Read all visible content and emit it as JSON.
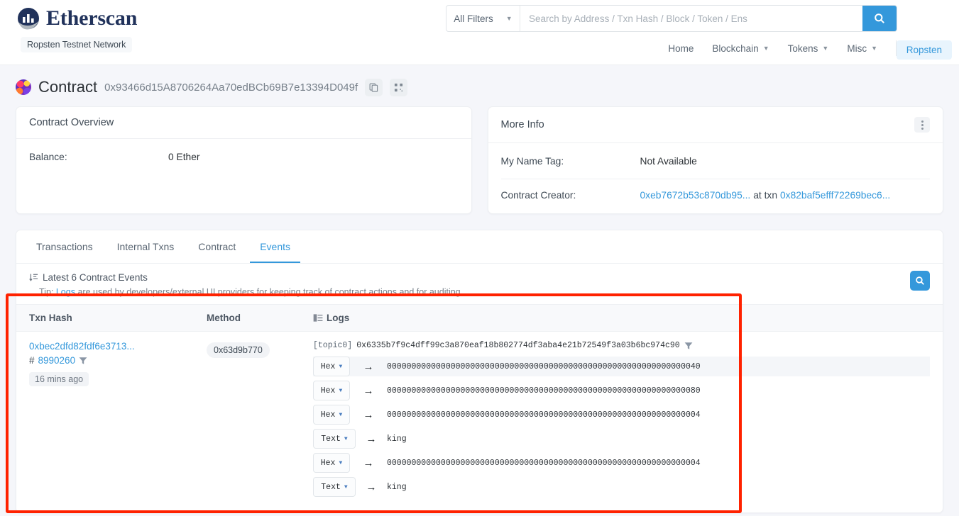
{
  "header": {
    "brand": "Etherscan",
    "network_badge": "Ropsten Testnet Network",
    "search": {
      "filters_label": "All Filters",
      "placeholder": "Search by Address / Txn Hash / Block / Token / Ens",
      "filters_icon": "chevron-down-icon",
      "submit_icon": "search-icon"
    },
    "nav": [
      {
        "label": "Home",
        "has_caret": false
      },
      {
        "label": "Blockchain",
        "has_caret": true
      },
      {
        "label": "Tokens",
        "has_caret": true
      },
      {
        "label": "Misc",
        "has_caret": true
      }
    ],
    "network_chip": "Ropsten"
  },
  "page": {
    "title": "Contract",
    "address": "0x93466d15A8706264Aa70edBCb69B7e13394D049f",
    "copy_icon": "copy-icon",
    "qr_icon": "qr-code-icon",
    "identicon": "contract-identicon"
  },
  "overview": {
    "title": "Contract Overview",
    "rows": [
      {
        "key": "Balance:",
        "value": "0 Ether"
      }
    ]
  },
  "more_info": {
    "title": "More Info",
    "menu_icon": "kebab-menu-icon",
    "name_tag": {
      "key": "My Name Tag:",
      "value": "Not Available"
    },
    "creator": {
      "key": "Contract Creator:",
      "creator_link": "0xeb7672b53c870db95...",
      "joiner": "at txn",
      "txn_link": "0x82baf5efff72269bec6..."
    }
  },
  "tabs": [
    {
      "label": "Transactions",
      "active": false
    },
    {
      "label": "Internal Txns",
      "active": false
    },
    {
      "label": "Contract",
      "active": false
    },
    {
      "label": "Events",
      "active": true
    }
  ],
  "events_header": {
    "sort_icon": "sort-descending-icon",
    "title": "Latest 6 Contract Events",
    "tip_prefix": "Tip:",
    "tip_link": "Logs",
    "tip_rest": "are used by developers/external UI providers for keeping track of contract actions and for auditing",
    "search_icon": "search-icon"
  },
  "table": {
    "columns": [
      "Txn Hash",
      "Method",
      "Logs"
    ],
    "logs_icon": "list-indent-icon",
    "rows": [
      {
        "txn_hash": "0xbec2dfd82fdf6e3713...",
        "block_prefix": "#",
        "block": "8990260",
        "block_filter_icon": "filter-icon",
        "age": "16 mins ago",
        "method": "0x63d9b770",
        "topic_label": "[topic0]",
        "topic_value": "0x6335b7f9c4dff99c3a870eaf18b802774df3aba4e21b72549f3a03b6bc974c90",
        "topic_filter_icon": "filter-icon",
        "data_rows": [
          {
            "format": "Hex",
            "arrow": "→",
            "value": "0000000000000000000000000000000000000000000000000000000000000040"
          },
          {
            "format": "Hex",
            "arrow": "→",
            "value": "0000000000000000000000000000000000000000000000000000000000000080"
          },
          {
            "format": "Hex",
            "arrow": "→",
            "value": "0000000000000000000000000000000000000000000000000000000000000004"
          },
          {
            "format": "Text",
            "arrow": "→",
            "value": "king"
          },
          {
            "format": "Hex",
            "arrow": "→",
            "value": "0000000000000000000000000000000000000000000000000000000000000004"
          },
          {
            "format": "Text",
            "arrow": "→",
            "value": "king"
          }
        ]
      }
    ]
  },
  "annotation": {
    "color": "#ff2200",
    "label": "logs-region-highlight"
  },
  "colors": {
    "accent": "#3498db",
    "brand": "#21325b",
    "page_bg": "#f5f6fa"
  }
}
